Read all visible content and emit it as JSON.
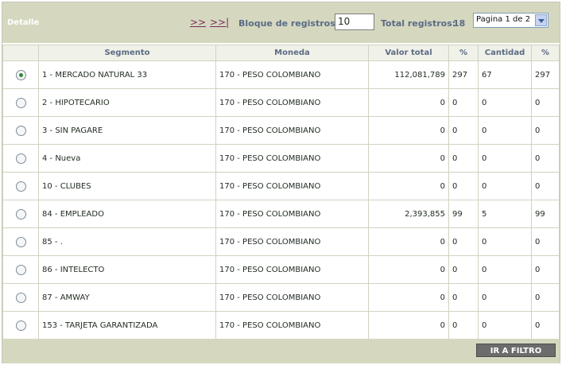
{
  "header": {
    "section_title": "Detalle",
    "nav_next": ">>",
    "nav_last": ">>|",
    "block_label": "Bloque de registros:",
    "block_value": "10",
    "total_label": "Total registros:",
    "total_value": "18",
    "page_select": "Pagina 1 de 2"
  },
  "table": {
    "columns": [
      "Segmento",
      "Moneda",
      "Valor total",
      "%",
      "Cantidad",
      "%"
    ],
    "rows": [
      {
        "selected": true,
        "segmento": "1 - MERCADO NATURAL 33",
        "moneda": "170 - PESO COLOMBIANO",
        "valor_total": "112,081,789",
        "pct_valor": "297",
        "cantidad": "67",
        "pct_cantidad": "297"
      },
      {
        "selected": false,
        "segmento": "2 - HIPOTECARIO",
        "moneda": "170 - PESO COLOMBIANO",
        "valor_total": "0",
        "pct_valor": "0",
        "cantidad": "0",
        "pct_cantidad": "0"
      },
      {
        "selected": false,
        "segmento": "3 - SIN PAGARE",
        "moneda": "170 - PESO COLOMBIANO",
        "valor_total": "0",
        "pct_valor": "0",
        "cantidad": "0",
        "pct_cantidad": "0"
      },
      {
        "selected": false,
        "segmento": "4 - Nueva",
        "moneda": "170 - PESO COLOMBIANO",
        "valor_total": "0",
        "pct_valor": "0",
        "cantidad": "0",
        "pct_cantidad": "0"
      },
      {
        "selected": false,
        "segmento": "10 - CLUBES",
        "moneda": "170 - PESO COLOMBIANO",
        "valor_total": "0",
        "pct_valor": "0",
        "cantidad": "0",
        "pct_cantidad": "0"
      },
      {
        "selected": false,
        "segmento": "84 - EMPLEADO",
        "moneda": "170 - PESO COLOMBIANO",
        "valor_total": "2,393,855",
        "pct_valor": "99",
        "cantidad": "5",
        "pct_cantidad": "99"
      },
      {
        "selected": false,
        "segmento": "85 - .",
        "moneda": "170 - PESO COLOMBIANO",
        "valor_total": "0",
        "pct_valor": "0",
        "cantidad": "0",
        "pct_cantidad": "0"
      },
      {
        "selected": false,
        "segmento": "86 - INTELECTO",
        "moneda": "170 - PESO COLOMBIANO",
        "valor_total": "0",
        "pct_valor": "0",
        "cantidad": "0",
        "pct_cantidad": "0"
      },
      {
        "selected": false,
        "segmento": "87 - AMWAY",
        "moneda": "170 - PESO COLOMBIANO",
        "valor_total": "0",
        "pct_valor": "0",
        "cantidad": "0",
        "pct_cantidad": "0"
      },
      {
        "selected": false,
        "segmento": "153 - TARJETA GARANTIZADA",
        "moneda": "170 - PESO COLOMBIANO",
        "valor_total": "0",
        "pct_valor": "0",
        "cantidad": "0",
        "pct_cantidad": "0"
      }
    ]
  },
  "footer": {
    "filter_button": "IR A FILTRO"
  }
}
